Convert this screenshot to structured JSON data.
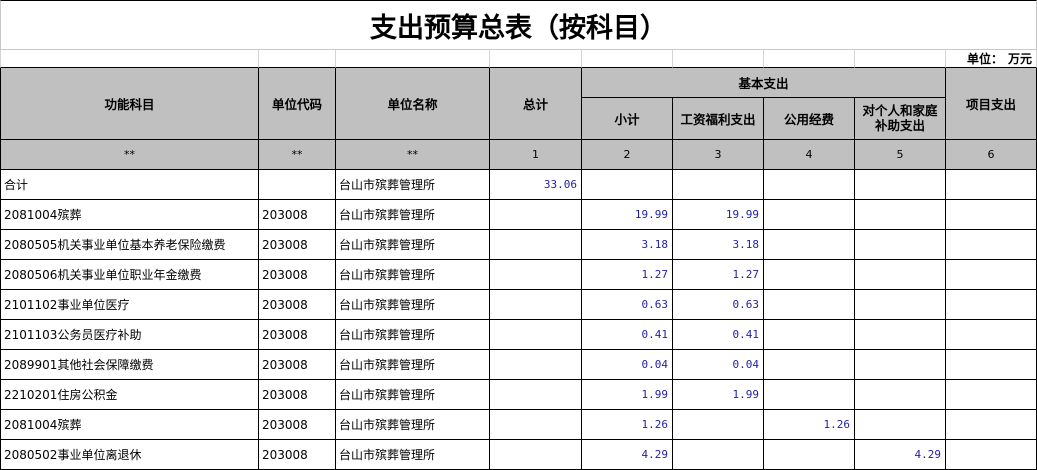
{
  "title": "支出预算总表（按科目）",
  "unit": {
    "label": "单位：",
    "value": "万元"
  },
  "header": {
    "function_subject": "功能科目",
    "unit_code": "单位代码",
    "unit_name": "单位名称",
    "total": "总计",
    "basic_expenditure": "基本支出",
    "subtotal": "小计",
    "wages_welfare": "工资福利支出",
    "public_funds": "公用经费",
    "personal_family_subsidy": "对个人和家庭补助支出",
    "project_expenditure": "项目支出"
  },
  "index_row": [
    "**",
    "**",
    "**",
    "1",
    "2",
    "3",
    "4",
    "5",
    "6"
  ],
  "rows": [
    {
      "subject": "合计",
      "code": "",
      "name": "台山市殡葬管理所",
      "total": "33.06",
      "subtotal": "",
      "wages_welfare": "",
      "public_funds": "",
      "personal_family_subsidy": "",
      "project": ""
    },
    {
      "subject": "2081004殡葬",
      "code": "203008",
      "name": "台山市殡葬管理所",
      "total": "",
      "subtotal": "19.99",
      "wages_welfare": "19.99",
      "public_funds": "",
      "personal_family_subsidy": "",
      "project": ""
    },
    {
      "subject": "2080505机关事业单位基本养老保险缴费",
      "code": "203008",
      "name": "台山市殡葬管理所",
      "total": "",
      "subtotal": "3.18",
      "wages_welfare": "3.18",
      "public_funds": "",
      "personal_family_subsidy": "",
      "project": ""
    },
    {
      "subject": "2080506机关事业单位职业年金缴费",
      "code": "203008",
      "name": "台山市殡葬管理所",
      "total": "",
      "subtotal": "1.27",
      "wages_welfare": "1.27",
      "public_funds": "",
      "personal_family_subsidy": "",
      "project": ""
    },
    {
      "subject": "2101102事业单位医疗",
      "code": "203008",
      "name": "台山市殡葬管理所",
      "total": "",
      "subtotal": "0.63",
      "wages_welfare": "0.63",
      "public_funds": "",
      "personal_family_subsidy": "",
      "project": ""
    },
    {
      "subject": "2101103公务员医疗补助",
      "code": "203008",
      "name": "台山市殡葬管理所",
      "total": "",
      "subtotal": "0.41",
      "wages_welfare": "0.41",
      "public_funds": "",
      "personal_family_subsidy": "",
      "project": ""
    },
    {
      "subject": "2089901其他社会保障缴费",
      "code": "203008",
      "name": "台山市殡葬管理所",
      "total": "",
      "subtotal": "0.04",
      "wages_welfare": "0.04",
      "public_funds": "",
      "personal_family_subsidy": "",
      "project": ""
    },
    {
      "subject": "2210201住房公积金",
      "code": "203008",
      "name": "台山市殡葬管理所",
      "total": "",
      "subtotal": "1.99",
      "wages_welfare": "1.99",
      "public_funds": "",
      "personal_family_subsidy": "",
      "project": ""
    },
    {
      "subject": "2081004殡葬",
      "code": "203008",
      "name": "台山市殡葬管理所",
      "total": "",
      "subtotal": "1.26",
      "wages_welfare": "",
      "public_funds": "1.26",
      "personal_family_subsidy": "",
      "project": ""
    },
    {
      "subject": "2080502事业单位离退休",
      "code": "203008",
      "name": "台山市殡葬管理所",
      "total": "",
      "subtotal": "4.29",
      "wages_welfare": "",
      "public_funds": "",
      "personal_family_subsidy": "4.29",
      "project": ""
    }
  ],
  "colors": {
    "header_fill": "#c0c0c0",
    "number_text": "#1f1fa6",
    "grid_line": "#000000"
  }
}
